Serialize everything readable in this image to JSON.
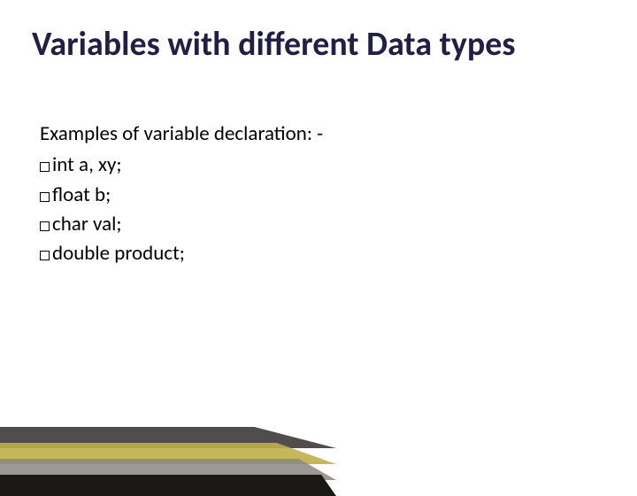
{
  "title": "Variables with different Data types",
  "intro": "Examples of variable declaration: -",
  "bullets": [
    {
      "kw": "int",
      "rest": " a, xy;"
    },
    {
      "kw": "float",
      "rest": " b;"
    },
    {
      "kw": "char",
      "rest": " val;"
    },
    {
      "kw": "double",
      "rest": " product;"
    }
  ]
}
